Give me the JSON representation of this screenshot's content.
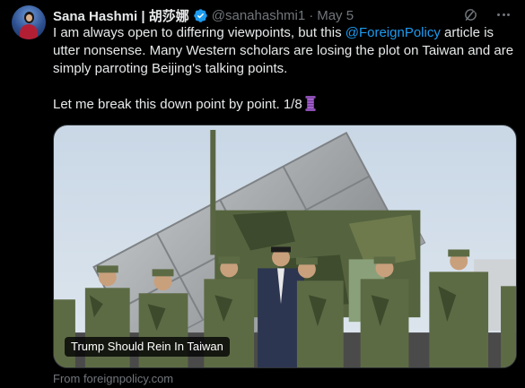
{
  "tweet": {
    "author_name": "Sana Hashmi | 胡莎娜",
    "handle": "@sanahashmi1",
    "separator": "·",
    "date": "May 5",
    "text_part1": "I am always open to differing viewpoints, but this ",
    "mention": "@ForeignPolicy",
    "text_part2": " article is utter nonsense. Many Western scholars are losing the plot on Taiwan and are simply parroting Beijing's talking points.",
    "text_line2": "Let me break this down point by point. 1/8",
    "thread_emoji_icon": "thread-spool-icon"
  },
  "card": {
    "title": "Trump Should Rein In Taiwan",
    "domain": "From foreignpolicy.com"
  },
  "colors": {
    "background": "#000000",
    "text": "#e7e9ea",
    "muted": "#71767b",
    "link": "#1d9bf0",
    "verified": "#1d9bf0"
  }
}
